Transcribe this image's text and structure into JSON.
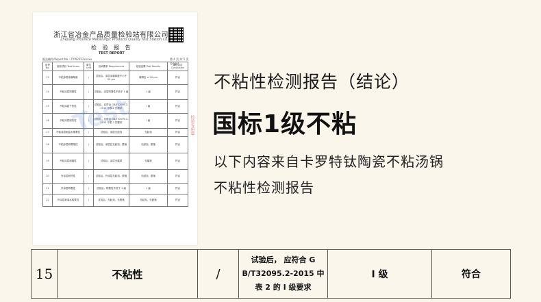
{
  "document": {
    "org_name": "浙江省冶金产品质量检验站有限公司",
    "org_name_en": "Zhejiang Province Metallurgic Products Quality Test Station Co.,Ltd",
    "title": "检 验 报 告",
    "title_en": "TEST REPORT",
    "report_no": "报告编号/Report No.: ZYW2022xxxxx",
    "page_no": "第 4 页 共 5 页(page)",
    "headers": [
      "序号 No.",
      "检验项目 Test Items",
      "单位 Unit",
      "技术要求 Requirement",
      "检验结果 Test Results",
      "单项评定 Conclusion"
    ],
    "rows": [
      [
        "13",
        "不粘涂层涂膜厚度",
        "/",
        "试验后，涂层涂膜厚度不小于 20 μm",
        "最薄处 ≥ 20 μm",
        "符合"
      ],
      [
        "14",
        "不粘涂层附着性",
        "/",
        "试验后，涂层附着性不低于 1 级",
        "1 级",
        "符合"
      ],
      [
        "15",
        "不粘涂层干热性",
        "/",
        "试验后，应符合 GB/T32095.2-2015 中表 2 的要求",
        "I 级",
        "符合"
      ],
      [
        "16",
        "不粘涂层耐热性",
        "/",
        "试验后，应符合 GB/T32095.2-2015 中表 2 的要求",
        "I 级",
        "符合"
      ],
      [
        "17",
        "不粘涂层耐盐水蒸煮性",
        "/",
        "试验后，涂层无起泡",
        "无起泡",
        "符合"
      ],
      [
        "18",
        "不粘涂层耐腐蚀性",
        "/",
        "试验后，涂层应无起泡、脱落",
        "无起泡、脱落",
        "符合"
      ],
      [
        "19",
        "不粘涂层耐磨性",
        "/",
        "试验后，涂层无磨穿",
        "无磨穿",
        "符合"
      ],
      [
        "20",
        "外涂层耐热性",
        "/",
        "试验后，外涂层无起泡、脱落",
        "无起泡、脱落",
        "符合"
      ],
      [
        "21",
        "外涂层附着性",
        "/",
        "试验后，附着性不低于 1 级",
        "1 级",
        "符合"
      ],
      [
        "22",
        "外涂层耐沸水蒸煮性",
        "/",
        "试验后，无起泡、无脱落",
        "无起泡、无脱落",
        "符合"
      ]
    ],
    "watermark": "Test",
    "stamp": "检验专用章"
  },
  "headline": "不粘性检测报告（结论）",
  "big_title": "国标1级不粘",
  "subtitle_line1": "以下内容来自卡罗特钛陶瓷不粘汤锅",
  "subtitle_line2": "不粘性检测报告",
  "bottom_row": {
    "no": "15",
    "item": "不粘性",
    "unit": "/",
    "req_line1": "试验后， 应符合 G",
    "req_line2": "B/T32095.2-2015 中",
    "req_line3": "表 2 的 I 级要求",
    "result": "I 级",
    "conclusion": "符合"
  }
}
